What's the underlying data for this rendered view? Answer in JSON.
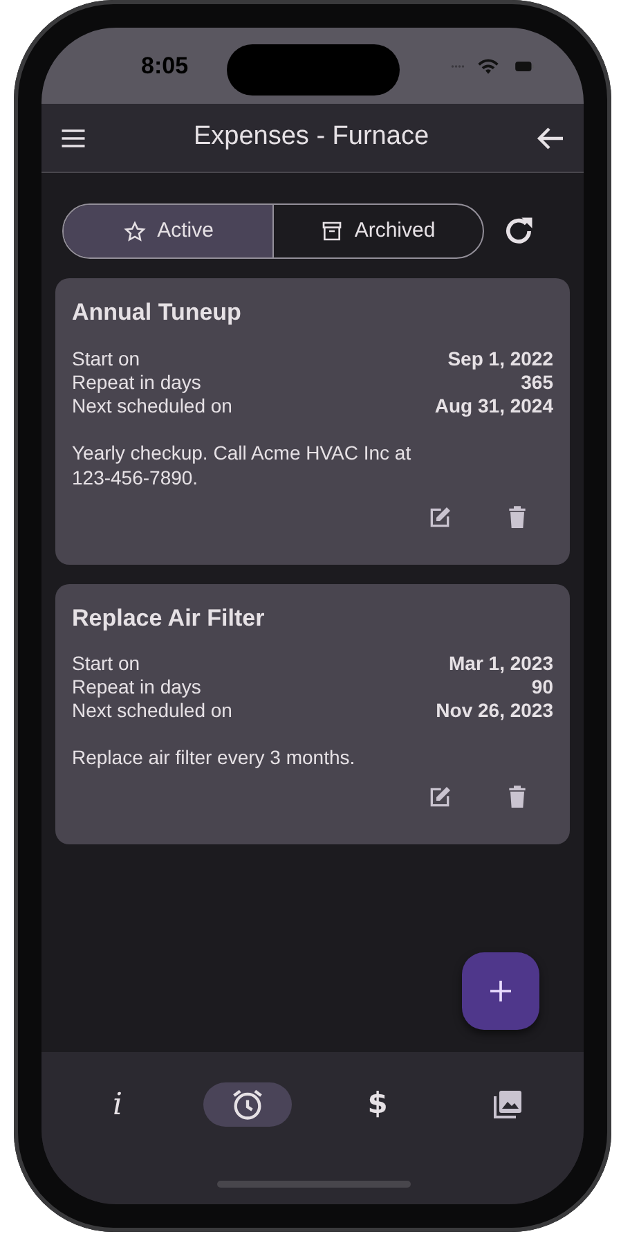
{
  "status_bar": {
    "time": "8:05"
  },
  "app_bar": {
    "title": "Expenses - Furnace"
  },
  "segments": [
    {
      "label": "Active",
      "kind": "star",
      "selected": true
    },
    {
      "label": "Archived",
      "kind": "archive",
      "selected": false
    }
  ],
  "cards": [
    {
      "title": "Annual Tuneup",
      "fields": [
        {
          "label": "Start on",
          "value": "Sep 1, 2022"
        },
        {
          "label": "Repeat in days",
          "value": "365"
        },
        {
          "label": "Next scheduled on",
          "value": "Aug 31, 2024"
        }
      ],
      "note": "Yearly checkup. Call Acme HVAC Inc at 123-456-7890."
    },
    {
      "title": "Replace Air Filter",
      "fields": [
        {
          "label": "Start on",
          "value": "Mar 1, 2023"
        },
        {
          "label": "Repeat in days",
          "value": "90"
        },
        {
          "label": "Next scheduled on",
          "value": "Nov 26, 2023"
        }
      ],
      "note": "Replace air filter every 3 months."
    }
  ],
  "nav": [
    {
      "kind": "glyph",
      "glyph": "i",
      "selected": false
    },
    {
      "kind": "alarm",
      "selected": true
    },
    {
      "kind": "glyph",
      "glyph": "$",
      "selected": false
    },
    {
      "kind": "photos",
      "selected": false
    }
  ]
}
